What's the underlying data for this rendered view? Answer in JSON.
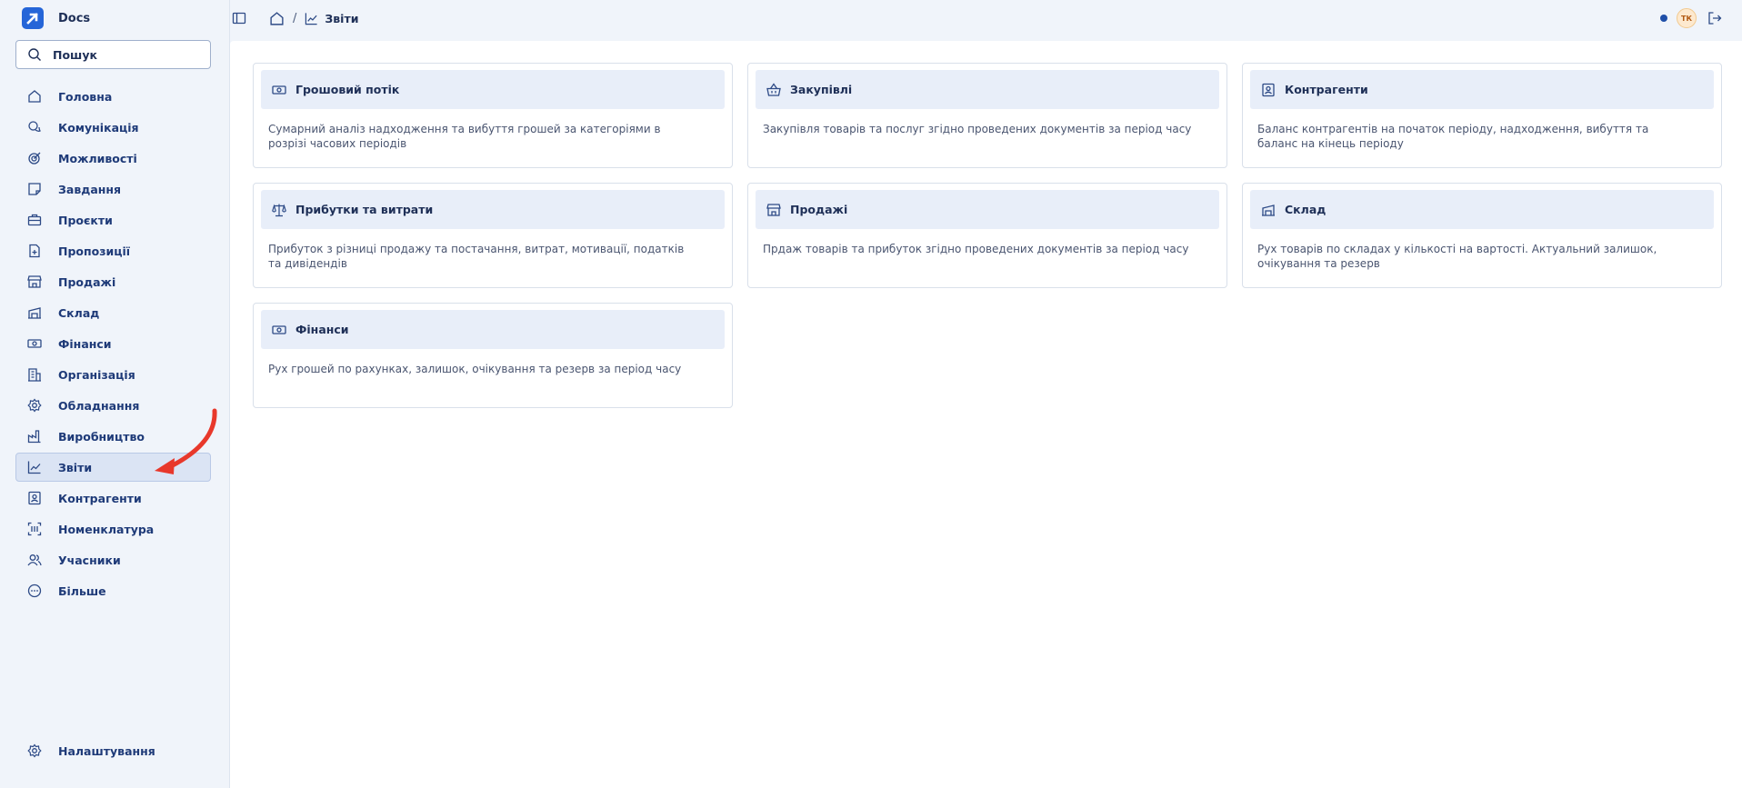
{
  "app": {
    "name": "Docs",
    "logo_icon": "docs-logo"
  },
  "search": {
    "label": "Пошук"
  },
  "sidebar": {
    "items": [
      {
        "label": "Головна",
        "icon": "home-icon"
      },
      {
        "label": "Комунікація",
        "icon": "chat-icon"
      },
      {
        "label": "Можливості",
        "icon": "target-icon"
      },
      {
        "label": "Завдання",
        "icon": "tasks-icon"
      },
      {
        "label": "Проєкти",
        "icon": "briefcase-icon"
      },
      {
        "label": "Пропозиції",
        "icon": "file-plus-icon"
      },
      {
        "label": "Продажі",
        "icon": "store-icon"
      },
      {
        "label": "Склад",
        "icon": "warehouse-icon"
      },
      {
        "label": "Фінанси",
        "icon": "banknote-icon"
      },
      {
        "label": "Організація",
        "icon": "building-icon"
      },
      {
        "label": "Обладнання",
        "icon": "gear-icon"
      },
      {
        "label": "Виробництво",
        "icon": "factory-icon"
      },
      {
        "label": "Звіти",
        "icon": "chart-line-icon",
        "active": true
      },
      {
        "label": "Контрагенти",
        "icon": "contact-icon"
      },
      {
        "label": "Номенклатура",
        "icon": "barcode-icon"
      },
      {
        "label": "Учасники",
        "icon": "users-icon"
      },
      {
        "label": "Більше",
        "icon": "more-icon"
      }
    ],
    "settings": {
      "label": "Налаштування",
      "icon": "gear-icon"
    }
  },
  "breadcrumb": {
    "current": "Звіти"
  },
  "user": {
    "initials": "ТК"
  },
  "reports": [
    {
      "title": "Грошовий потік",
      "icon": "banknote-icon",
      "description": "Сумарний аналіз надходження та вибуття грошей за категоріями в розрізі часових періодів"
    },
    {
      "title": "Закупівлі",
      "icon": "basket-icon",
      "description": "Закупівля товарів та послуг згідно проведених документів за період часу"
    },
    {
      "title": "Контрагенти",
      "icon": "contact-icon",
      "description": "Баланс контрагентів на початок періоду, надходження, вибуття та баланс на кінець періоду"
    },
    {
      "title": "Прибутки та витрати",
      "icon": "scale-icon",
      "description": "Прибуток з різниці продажу та постачання, витрат, мотивації, податків та дивідендів"
    },
    {
      "title": "Продажі",
      "icon": "store-icon",
      "description": "Прдаж товарів та прибуток згідно проведених документів за період часу"
    },
    {
      "title": "Склад",
      "icon": "warehouse-icon",
      "description": "Рух товарів по складах у кількості на вартості. Актуальний залишок, очікування та резерв"
    },
    {
      "title": "Фінанси",
      "icon": "banknote-icon",
      "description": "Рух грошей по рахунках, залишок, очікування та резерв за період часу"
    }
  ],
  "colors": {
    "sidebar_bg": "#f0f4fa",
    "accent": "#2565d8",
    "active_bg": "#dbe4f4",
    "card_header_bg": "#e8eef9",
    "annotation_arrow": "#e8382b"
  }
}
